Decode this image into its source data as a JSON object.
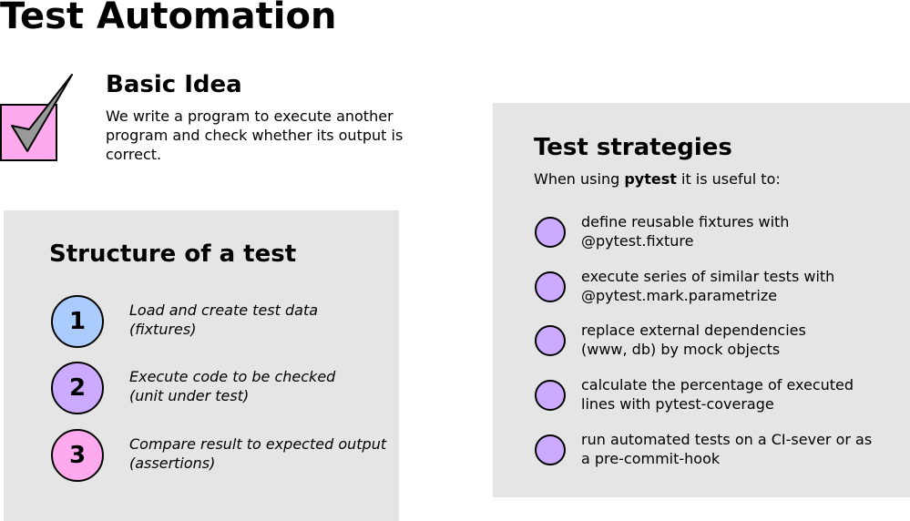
{
  "title": "Test Automation",
  "colors": {
    "checkbox_fill": "#ffaaee",
    "checkmark_fill": "#999999",
    "panel_background": "#e5e5e5",
    "step_colors": [
      "#aaccff",
      "#ccaaff",
      "#ffaaee"
    ],
    "bullet_color": "#ccaaff"
  },
  "basic_idea": {
    "icon": "checkbox-checked-icon",
    "heading": "Basic Idea",
    "text": "We write a program to execute another program and check whether its output is correct."
  },
  "structure": {
    "heading": "Structure of a test",
    "steps": [
      {
        "number": "1",
        "line1": "Load and create test data",
        "line2": "(fixtures)"
      },
      {
        "number": "2",
        "line1": "Execute code to be checked",
        "line2": "(unit under test)"
      },
      {
        "number": "3",
        "line1": "Compare result to expected output",
        "line2": "(assertions)"
      }
    ]
  },
  "strategies": {
    "heading": "Test strategies",
    "intro_prefix": "When using ",
    "intro_bold": "pytest",
    "intro_suffix": " it is useful to:",
    "items": [
      {
        "line1": "define reusable fixtures with",
        "line2": "@pytest.fixture"
      },
      {
        "line1": "execute series of similar tests with",
        "line2": "@pytest.mark.parametrize"
      },
      {
        "line1": "replace external dependencies",
        "line2": "(www, db) by mock objects"
      },
      {
        "line1": "calculate the percentage of executed",
        "line2": "lines with pytest-coverage"
      },
      {
        "line1": "run automated tests on a CI-sever or as",
        "line2": "a pre-commit-hook"
      }
    ]
  }
}
